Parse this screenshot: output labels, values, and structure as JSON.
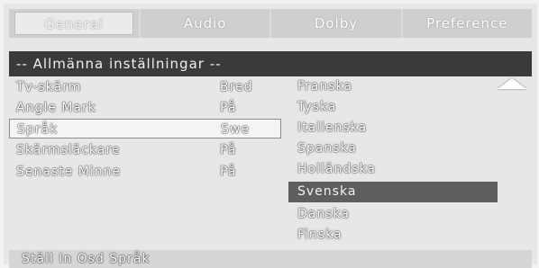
{
  "tabs": [
    {
      "label": "General"
    },
    {
      "label": "Audio"
    },
    {
      "label": "Dolby"
    },
    {
      "label": "Preference"
    }
  ],
  "header": {
    "title": "--  Allmänna inställningar  --"
  },
  "settings": [
    {
      "label": "Tv-skärm",
      "value": "Bred"
    },
    {
      "label": "Angle Mark",
      "value": "På"
    },
    {
      "label": "Språk",
      "value": "Swe"
    },
    {
      "label": "Skärmsläckare",
      "value": "På"
    },
    {
      "label": "Senaste Minne",
      "value": "På"
    }
  ],
  "options": [
    {
      "label": "Franska"
    },
    {
      "label": "Tyska"
    },
    {
      "label": "Italienska"
    },
    {
      "label": "Spanska"
    },
    {
      "label": "Holländska"
    },
    {
      "label": "Svenska"
    },
    {
      "label": "Danska"
    },
    {
      "label": "Finska"
    }
  ],
  "footer": {
    "hint": "Ställ In Osd Språk"
  },
  "selected": {
    "setting": "Språk",
    "option": "Svenska"
  },
  "icons": {
    "scroll_up": "scroll-up-arrow-icon"
  }
}
